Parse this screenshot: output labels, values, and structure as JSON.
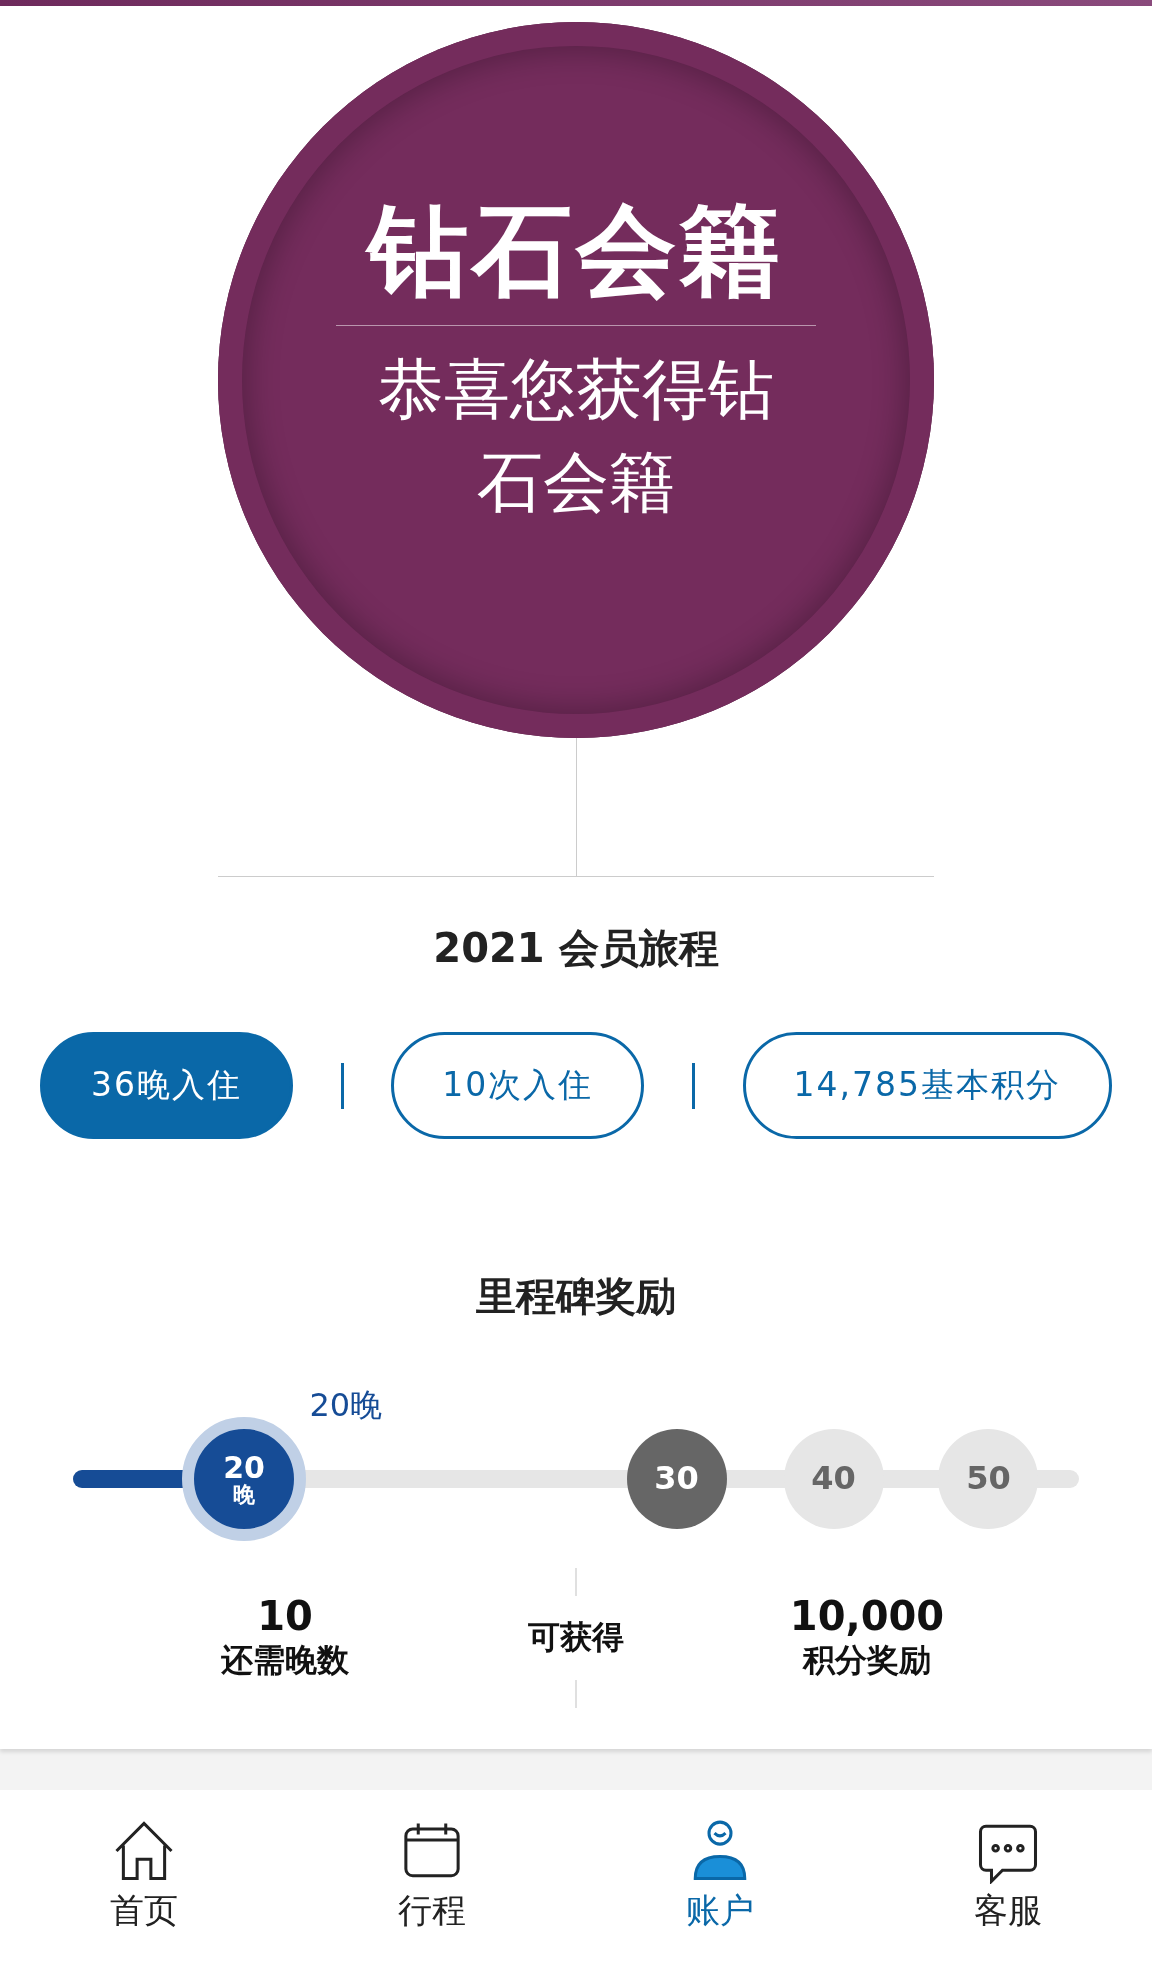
{
  "tier": {
    "title": "钻石会籍",
    "message": "恭喜您获得钻石会籍"
  },
  "journey": {
    "title": "2021 会员旅程",
    "stats": [
      {
        "label": "36晚入住",
        "selected": true
      },
      {
        "label": "10次入住",
        "selected": false
      },
      {
        "label": "14,785基本积分",
        "selected": false
      }
    ]
  },
  "milestones": {
    "title": "里程碑奖励",
    "level": 0.23,
    "current_label": "20晚",
    "markers": [
      {
        "value": "20",
        "unit": "晚",
        "kind": "current"
      },
      {
        "value": "30",
        "kind": "next"
      },
      {
        "value": "40",
        "kind": "locked"
      },
      {
        "value": "50",
        "kind": "locked"
      }
    ],
    "remaining": {
      "value": "10",
      "label": "还需晚数"
    },
    "middle": "可获得",
    "reward": {
      "value": "10,000",
      "label": "积分奖励"
    }
  },
  "nav": [
    {
      "label": "首页",
      "kind": "home",
      "selected": false
    },
    {
      "label": "行程",
      "kind": "calendar",
      "selected": false
    },
    {
      "label": "账户",
      "kind": "account",
      "selected": true
    },
    {
      "label": "客服",
      "kind": "chat",
      "selected": false
    }
  ]
}
